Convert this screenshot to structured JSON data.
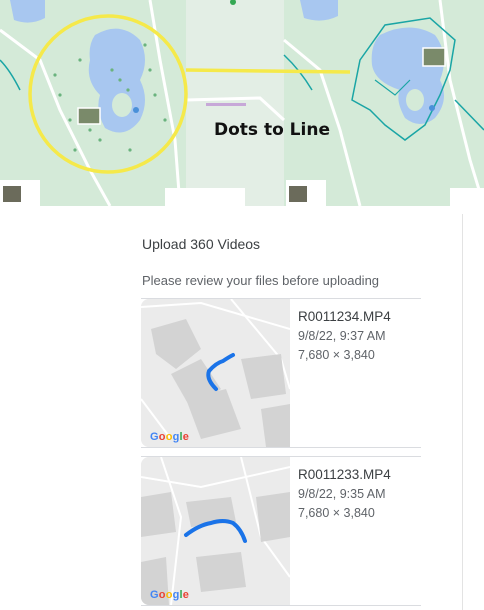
{
  "hero": {
    "caption": "Dots to Line"
  },
  "dialog": {
    "title": "Upload 360 Videos",
    "subtitle": "Please review your files before uploading",
    "files": [
      {
        "name": "R0011234.MP4",
        "datetime": "9/8/22, 9:37 AM",
        "resolution": "7,680 × 3,840"
      },
      {
        "name": "R0011233.MP4",
        "datetime": "9/8/22, 9:35 AM",
        "resolution": "7,680 × 3,840"
      }
    ],
    "map_brand": "Google"
  },
  "colors": {
    "map_green": "#cfe8d3",
    "water_blue": "#a8c7f0",
    "highlight_yellow": "#f5e94a",
    "track_blue": "#1a73e8",
    "line_teal": "#1aa5a5"
  }
}
